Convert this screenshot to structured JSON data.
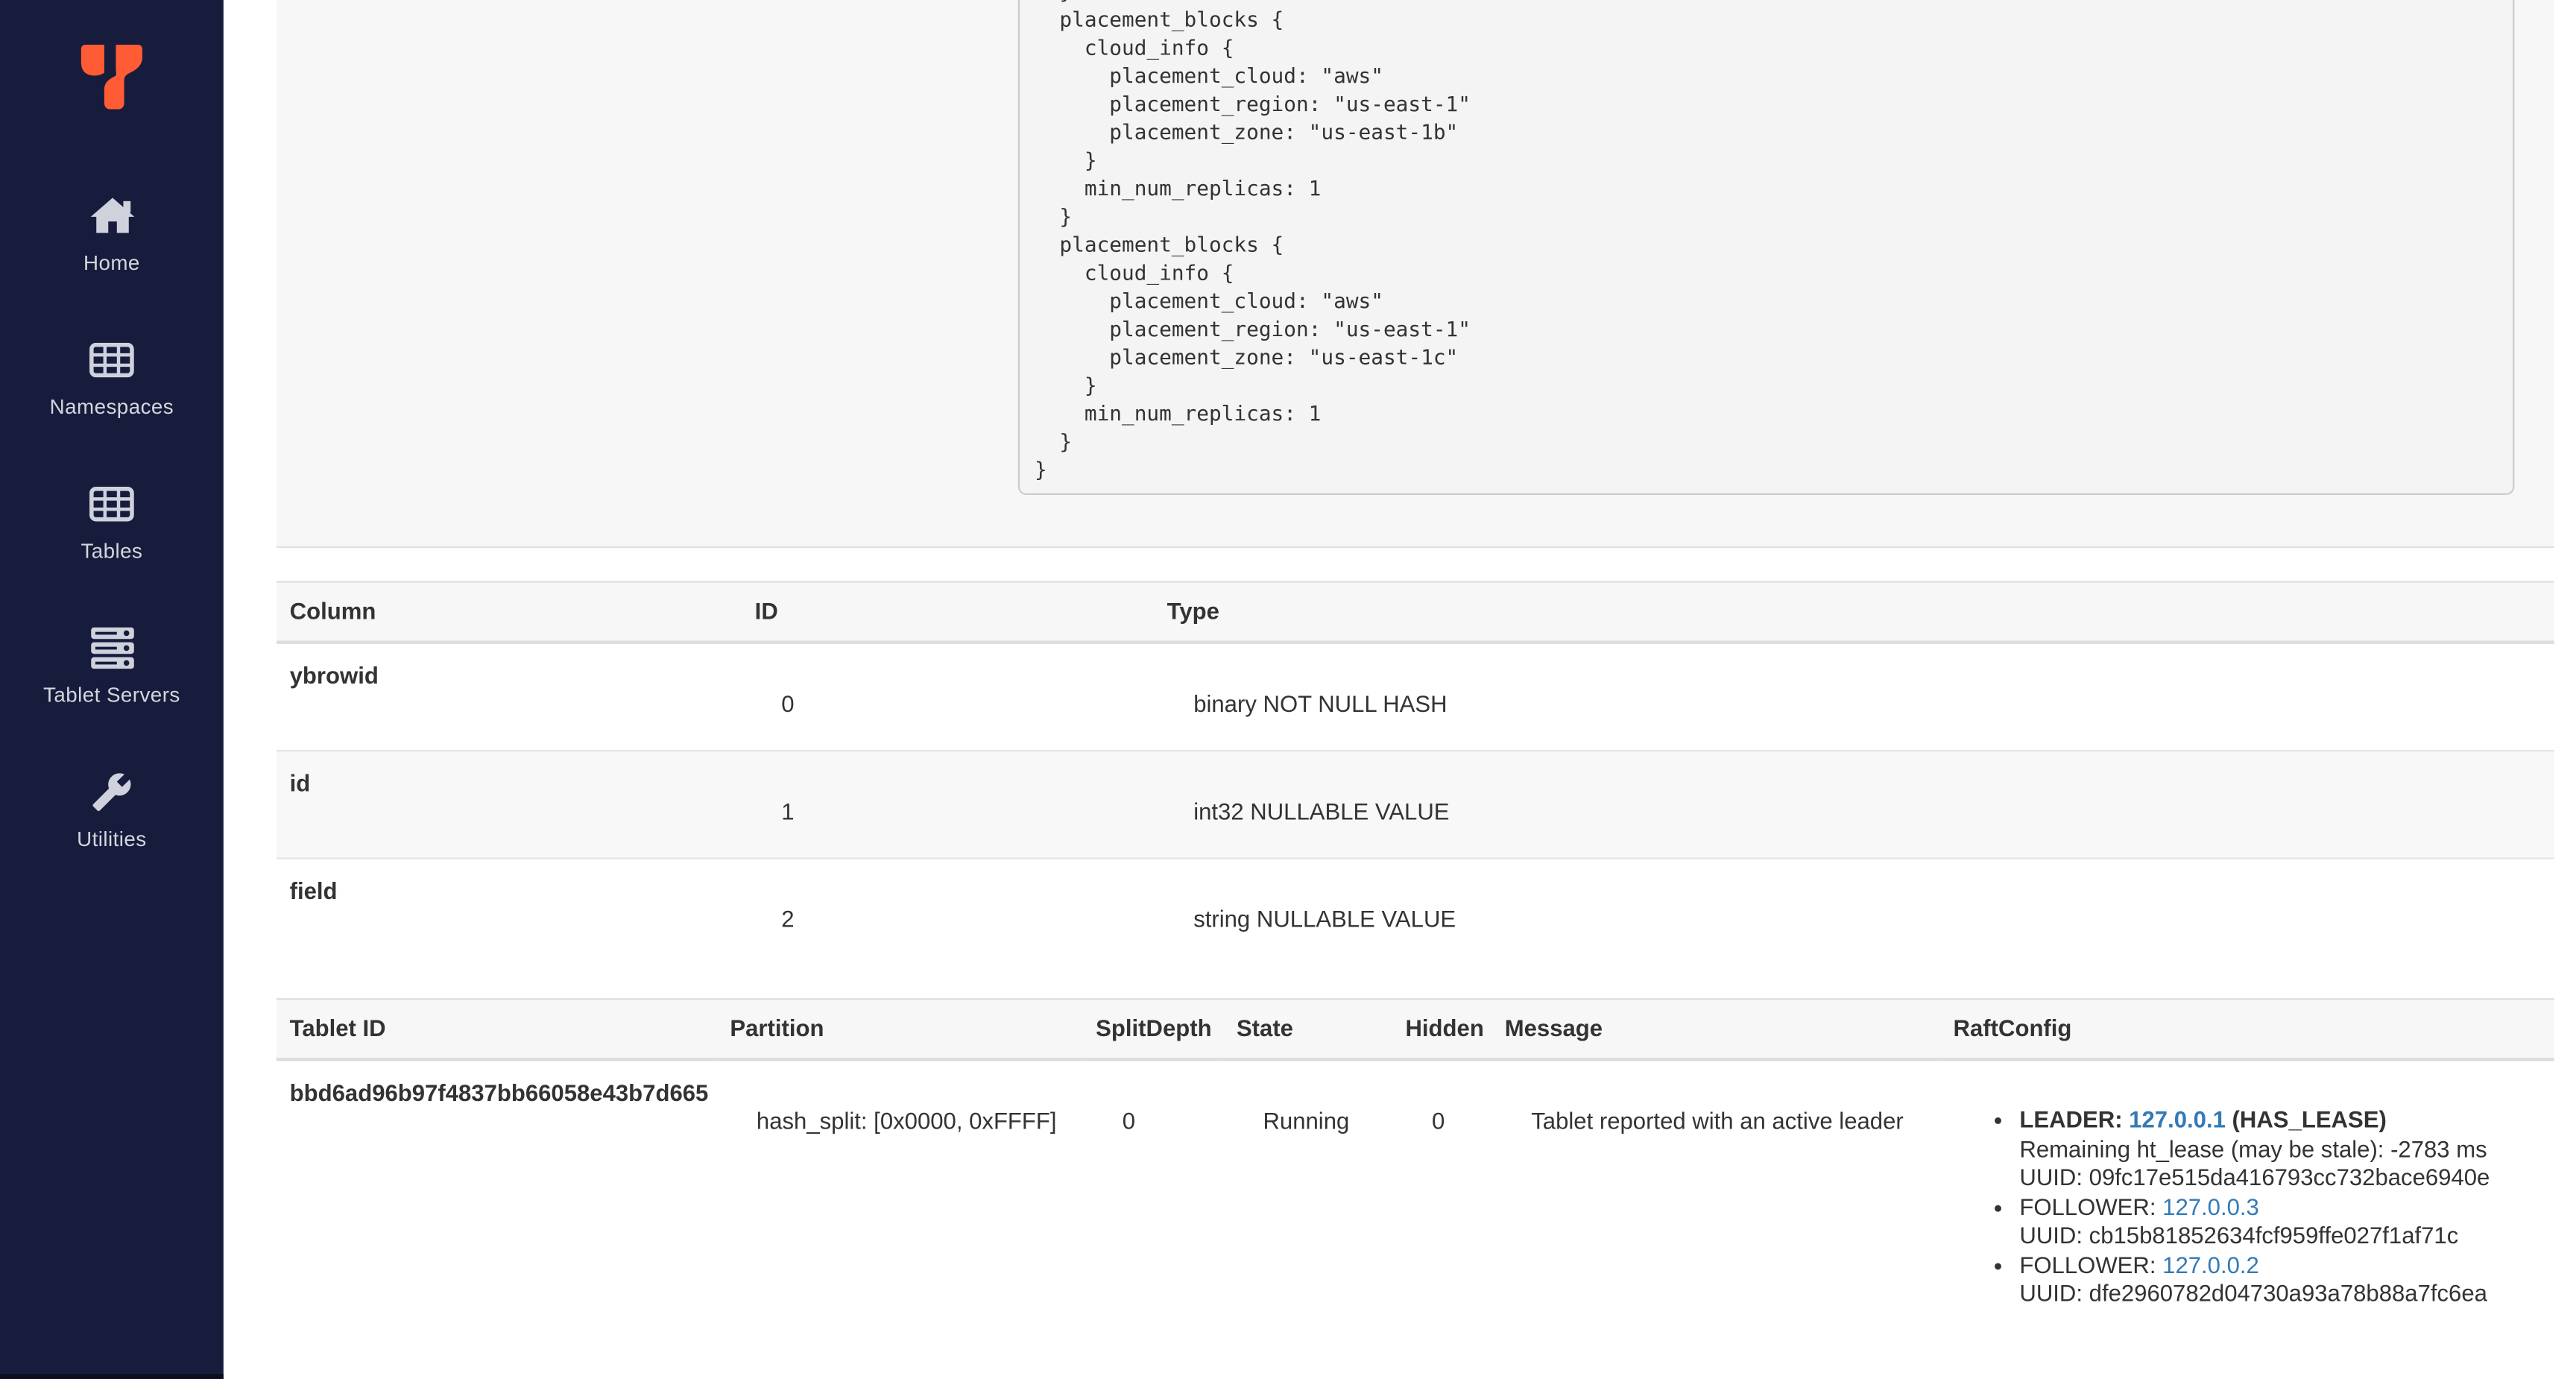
{
  "sidebar": {
    "items": [
      {
        "label": "Home"
      },
      {
        "label": "Namespaces"
      },
      {
        "label": "Tables"
      },
      {
        "label": "Tablet Servers"
      },
      {
        "label": "Utilities"
      }
    ]
  },
  "replication_info_code": {
    "content": "  }\n  placement_blocks {\n    cloud_info {\n      placement_cloud: \"aws\"\n      placement_region: \"us-east-1\"\n      placement_zone: \"us-east-1b\"\n    }\n    min_num_replicas: 1\n  }\n  placement_blocks {\n    cloud_info {\n      placement_cloud: \"aws\"\n      placement_region: \"us-east-1\"\n      placement_zone: \"us-east-1c\"\n    }\n    min_num_replicas: 1\n  }\n}"
  },
  "schema_table": {
    "headers": {
      "column": "Column",
      "id": "ID",
      "type": "Type"
    },
    "rows": [
      {
        "name": "ybrowid",
        "id": "0",
        "type": "binary NOT NULL HASH"
      },
      {
        "name": "id",
        "id": "1",
        "type": "int32 NULLABLE VALUE"
      },
      {
        "name": "field",
        "id": "2",
        "type": "string NULLABLE VALUE"
      }
    ]
  },
  "tablet_table": {
    "headers": {
      "tablet_id": "Tablet ID",
      "partition": "Partition",
      "split_depth": "SplitDepth",
      "state": "State",
      "hidden": "Hidden",
      "message": "Message",
      "raft_config": "RaftConfig"
    },
    "row": {
      "tablet_id": "bbd6ad96b97f4837bb66058e43b7d665",
      "partition": "hash_split: [0x0000, 0xFFFF]",
      "split_depth": "0",
      "state": "Running",
      "hidden": "0",
      "message": "Tablet reported with an active leader",
      "raft": [
        {
          "role": "LEADER:",
          "address": "127.0.0.1",
          "flag": "(HAS_LEASE)",
          "lease": "Remaining ht_lease (may be stale): -2783 ms",
          "uuid": "UUID: 09fc17e515da416793cc732bace6940e"
        },
        {
          "role": "FOLLOWER:",
          "address": "127.0.0.3",
          "uuid": "UUID: cb15b81852634fcf959ffe027f1af71c"
        },
        {
          "role": "FOLLOWER:",
          "address": "127.0.0.2",
          "uuid": "UUID: dfe2960782d04730a93a78b88a7fc6ea"
        }
      ]
    }
  },
  "colors": {
    "sidebar_bg": "#181c3c",
    "brand_orange": "#ff5c35",
    "link_blue": "#337ab7",
    "panel_bg": "#f7f7f8",
    "code_bg": "#f4f4f5"
  }
}
